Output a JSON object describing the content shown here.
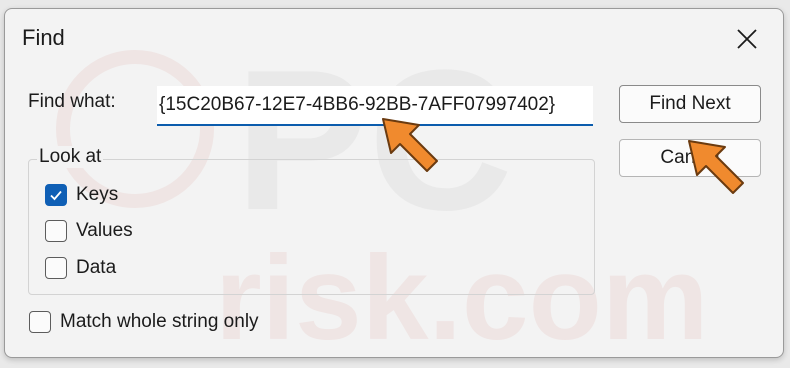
{
  "dialog": {
    "title": "Find",
    "close_icon": "close-icon"
  },
  "find": {
    "label": "Find what:",
    "value": "{15C20B67-12E7-4BB6-92BB-7AFF07997402}"
  },
  "buttons": {
    "find_next": "Find Next",
    "cancel": "Cancel"
  },
  "look_at": {
    "label": "Look at",
    "options": [
      {
        "label": "Keys",
        "checked": true
      },
      {
        "label": "Values",
        "checked": false
      },
      {
        "label": "Data",
        "checked": false
      }
    ]
  },
  "match_whole": {
    "label": "Match whole string only",
    "checked": false
  },
  "colors": {
    "accent": "#0f5fb5",
    "annotation_arrow": "#f08a2e"
  }
}
